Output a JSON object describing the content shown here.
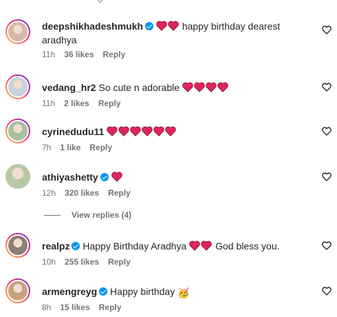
{
  "comments": [
    {
      "username": "deepshikhadeshmukh",
      "verified": true,
      "hearts_before": 2,
      "text_lines": [
        "happy birthday dearest",
        "aradhya"
      ],
      "hearts_after": 0,
      "text_after": "",
      "time": "11h",
      "likes": "36 likes",
      "reply": "Reply",
      "avatar_style": "ring",
      "avatar_color": "#d8b8a8"
    },
    {
      "username": "vedang_hr2",
      "verified": false,
      "hearts_before": 0,
      "text_lines": [
        "So cute n adorable"
      ],
      "hearts_after": 4,
      "text_after": "",
      "time": "11h",
      "likes": "2 likes",
      "reply": "Reply",
      "avatar_style": "ring",
      "avatar_color": "#c7d4de"
    },
    {
      "username": "cyrinedudu11",
      "verified": false,
      "hearts_before": 6,
      "text_lines": [
        ""
      ],
      "hearts_after": 0,
      "text_after": "",
      "time": "7h",
      "likes": "1 like",
      "reply": "Reply",
      "avatar_style": "ring",
      "avatar_color": "#a9c2a0"
    },
    {
      "username": "athiyashetty",
      "verified": true,
      "hearts_before": 1,
      "text_lines": [
        ""
      ],
      "hearts_after": 0,
      "text_after": "",
      "time": "12h",
      "likes": "320 likes",
      "reply": "Reply",
      "avatar_style": "plain",
      "avatar_color": "#b6c9a4"
    },
    {
      "username": "realpz",
      "verified": true,
      "hearts_before": 0,
      "text_lines": [
        "Happy Birthday Aradhya"
      ],
      "hearts_after": 2,
      "text_after": "God bless you.",
      "time": "10h",
      "likes": "255 likes",
      "reply": "Reply",
      "avatar_style": "ring",
      "avatar_color": "#8c7f76"
    },
    {
      "username": "armengreyg",
      "verified": true,
      "hearts_before": 0,
      "text_lines": [
        "Happy birthday"
      ],
      "hearts_after": 0,
      "text_after": "",
      "emoji_after": "🥳",
      "time": "8h",
      "likes": "15 likes",
      "reply": "Reply",
      "avatar_style": "ring",
      "avatar_color": "#c9a27c"
    }
  ],
  "view_replies": "View replies (4)",
  "icons": {
    "like": "heart-outline-icon",
    "reaction": "red-heart-emoji",
    "verified": "verified-badge-icon"
  },
  "colors": {
    "heart": "#e0245e",
    "verified": "#0095f6",
    "meta": "#737373",
    "text": "#262626"
  }
}
